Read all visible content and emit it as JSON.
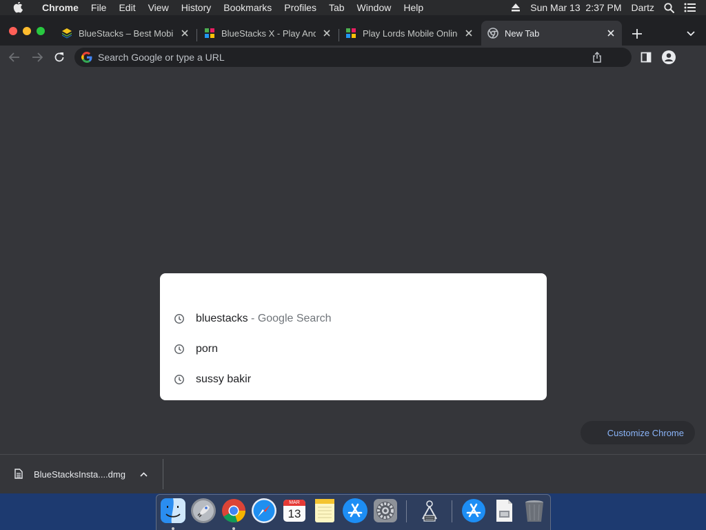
{
  "menubar": {
    "apple_icon": "apple-logo-icon",
    "app_name": "Chrome",
    "items": [
      "File",
      "Edit",
      "View",
      "History",
      "Bookmarks",
      "Profiles",
      "Tab",
      "Window",
      "Help"
    ],
    "datetime": "Sun Mar 13  2:37 PM",
    "user": "Dartz",
    "icons": [
      "eject-icon",
      "spotlight-search-icon",
      "control-center-icon"
    ]
  },
  "tabs": [
    {
      "title": "BlueStacks – Best Mobile Gaming Platform",
      "icon": "bluestacks-favicon",
      "active": false
    },
    {
      "title": "BlueStacks X - Play Android Games",
      "icon": "bluestacks-x-favicon",
      "active": false
    },
    {
      "title": "Play Lords Mobile Online",
      "icon": "bluestacks-x-favicon",
      "active": false
    },
    {
      "title": "New Tab",
      "icon": "chrome-favicon",
      "active": true
    }
  ],
  "toolbar": {
    "omnibox_placeholder": "Search Google or type a URL"
  },
  "suggestions": [
    {
      "query": "bluestacks",
      "suffix": " - Google Search"
    },
    {
      "query": "porn",
      "suffix": ""
    },
    {
      "query": "sussy bakir",
      "suffix": ""
    }
  ],
  "customize_label": "Customize Chrome",
  "download": {
    "filename": "BlueStacksInsta....dmg"
  },
  "dock": {
    "apps": [
      "finder",
      "launchpad",
      "chrome",
      "safari",
      "calendar",
      "notes",
      "app-store",
      "system-preferences",
      "directory-utility",
      "app-store-folder",
      "documents-folder",
      "trash"
    ],
    "calendar": {
      "month": "MAR",
      "day": "13"
    }
  },
  "colors": {
    "accent_link": "#8ab4f8",
    "tabstrip_bg": "#202124",
    "toolbar_bg": "#35363a"
  }
}
